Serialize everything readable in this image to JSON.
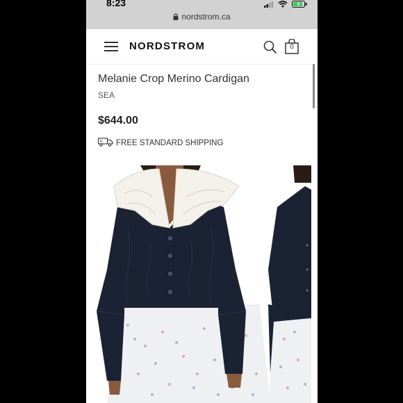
{
  "status_bar": {
    "time": "8:23"
  },
  "browser": {
    "url": "nordstrom.ca"
  },
  "header": {
    "logo": "NORDSTROM",
    "bag_count": "0"
  },
  "product": {
    "title": "Melanie Crop Merino Cardigan",
    "brand": "SEA",
    "price": "$644.00",
    "shipping": "FREE STANDARD SHIPPING"
  },
  "colors": {
    "cardigan": "#1b2233",
    "collar": "#f3f1ea",
    "skirt": "#eef0f2",
    "skin": "#8a5a3f"
  }
}
